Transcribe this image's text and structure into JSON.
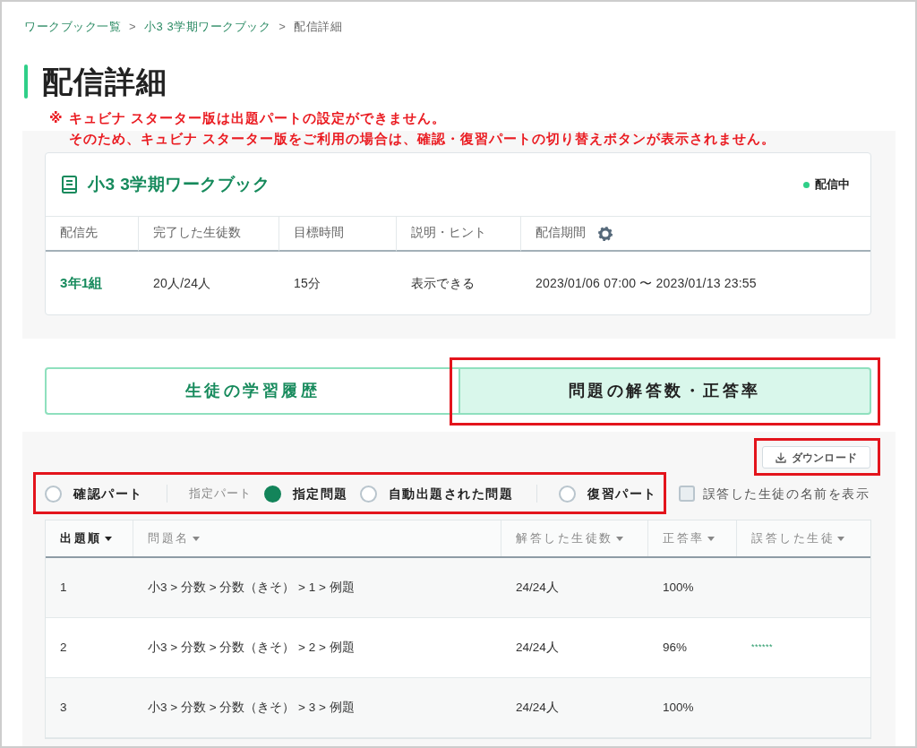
{
  "breadcrumb": [
    {
      "label": "ワークブック一覧",
      "current": false,
      "separator": ">"
    },
    {
      "label": "小3 3学期ワークブック",
      "current": false,
      "separator": ">"
    },
    {
      "label": "配信詳細",
      "current": true
    }
  ],
  "page_title": "配信詳細",
  "note": {
    "mark": "※",
    "lines": [
      "キュビナ スターター版は出題パートの設定ができません。",
      "そのため、キュビナ スターター版をご利用の場合は、確認・復習パートの切り替えボタンが表示されません。"
    ]
  },
  "delivery": {
    "title": "小3 3学期ワークブック",
    "status": "配信中",
    "columns": [
      {
        "label": "配信先",
        "settings": false
      },
      {
        "label": "完了した生徒数",
        "settings": false
      },
      {
        "label": "目標時間",
        "settings": false
      },
      {
        "label": "説明・ヒント",
        "settings": false
      },
      {
        "label": "配信期間",
        "settings": true
      }
    ],
    "row": [
      {
        "text": "3年1組",
        "link": true
      },
      {
        "text": "20人/24人",
        "link": false
      },
      {
        "text": "15分",
        "link": false
      },
      {
        "text": "表示できる",
        "link": false
      },
      {
        "text": "2023/01/06 07:00 〜 2023/01/13 23:55",
        "link": false
      }
    ]
  },
  "tabs": [
    {
      "label": "生徒の学習履歴",
      "selected": false,
      "highlighted": false
    },
    {
      "label": "問題の解答数・正答率",
      "selected": true,
      "highlighted": true
    }
  ],
  "download": {
    "label": "ダウンロード",
    "highlighted": true
  },
  "part_filter": {
    "highlighted": true,
    "groups": [
      {
        "options": [
          {
            "label": "確認パート",
            "selected": false
          }
        ]
      },
      {
        "caption": "指定パート",
        "options": [
          {
            "label": "指定問題",
            "selected": true
          },
          {
            "label": "自動出題された問題",
            "selected": false
          }
        ]
      },
      {
        "options": [
          {
            "label": "復習パート",
            "selected": false
          }
        ]
      }
    ]
  },
  "show_wrong_names": {
    "label": "誤答した生徒の名前を表示",
    "checked": false
  },
  "questions": {
    "columns": [
      {
        "label": "出題順",
        "sorted": true
      },
      {
        "label": "問題名",
        "sorted": false
      },
      {
        "label": "解答した生徒数",
        "sorted": false
      },
      {
        "label": "正答率",
        "sorted": false
      },
      {
        "label": "誤答した生徒",
        "sorted": false
      }
    ],
    "rows": [
      {
        "order": "1",
        "name": "小3 > 分数 > 分数（きそ） > 1 > 例題",
        "answered": "24/24人",
        "rate": "100%"
      },
      {
        "order": "2",
        "name": "小3 > 分数 > 分数（きそ） > 2 > 例題",
        "answered": "24/24人",
        "rate": "96%",
        "wrong": "******"
      },
      {
        "order": "3",
        "name": "小3 > 分数 > 分数（きそ） > 3 > 例題",
        "answered": "24/24人",
        "rate": "100%"
      }
    ]
  }
}
